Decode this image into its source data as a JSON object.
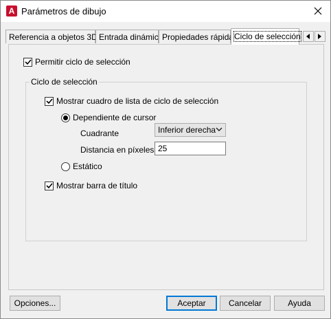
{
  "window": {
    "title": "Parámetros de dibujo",
    "app_icon_letter": "A"
  },
  "tabs": [
    {
      "label": "Referencia a objetos 3D"
    },
    {
      "label": "Entrada dinámica"
    },
    {
      "label": "Propiedades rápidas"
    },
    {
      "label": "Ciclo de selección",
      "active": true
    }
  ],
  "panel": {
    "enable_cycling": {
      "label": "Permitir ciclo de selección",
      "checked": true
    },
    "group": {
      "legend": "Ciclo de selección",
      "show_list_box": {
        "label": "Mostrar cuadro de lista de ciclo de selección",
        "checked": true
      },
      "cursor_dependent": {
        "label": "Dependiente de cursor",
        "selected": true
      },
      "quadrant": {
        "label": "Cuadrante",
        "value": "Inferior derecha"
      },
      "distance": {
        "label": "Distancia en píxeles",
        "value": "25"
      },
      "static": {
        "label": "Estático",
        "selected": false
      },
      "show_title_bar": {
        "label": "Mostrar barra de título",
        "checked": true
      }
    }
  },
  "buttons": {
    "options": "Opciones...",
    "accept": "Aceptar",
    "cancel": "Cancelar",
    "help": "Ayuda"
  },
  "colors": {
    "app_icon": "#c8102e",
    "default_button_border": "#0078d7"
  }
}
